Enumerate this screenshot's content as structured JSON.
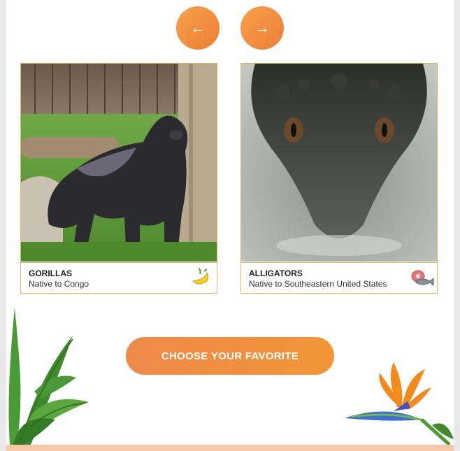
{
  "nav": {
    "prev_glyph": "←",
    "next_glyph": "→"
  },
  "cards": [
    {
      "name": "GORILLAS",
      "native": "Native to Congo",
      "food_icon": "banana-icon"
    },
    {
      "name": "ALLIGATORS",
      "native": "Native to Southeastern United States",
      "food_icon": "meat-fish-icon"
    }
  ],
  "cta": {
    "label": "CHOOSE YOUR FAVORITE"
  },
  "colors": {
    "accent_orange": "#f08a3e",
    "card_border": "#e8b45a",
    "footer_band": "#f6c8a7"
  }
}
